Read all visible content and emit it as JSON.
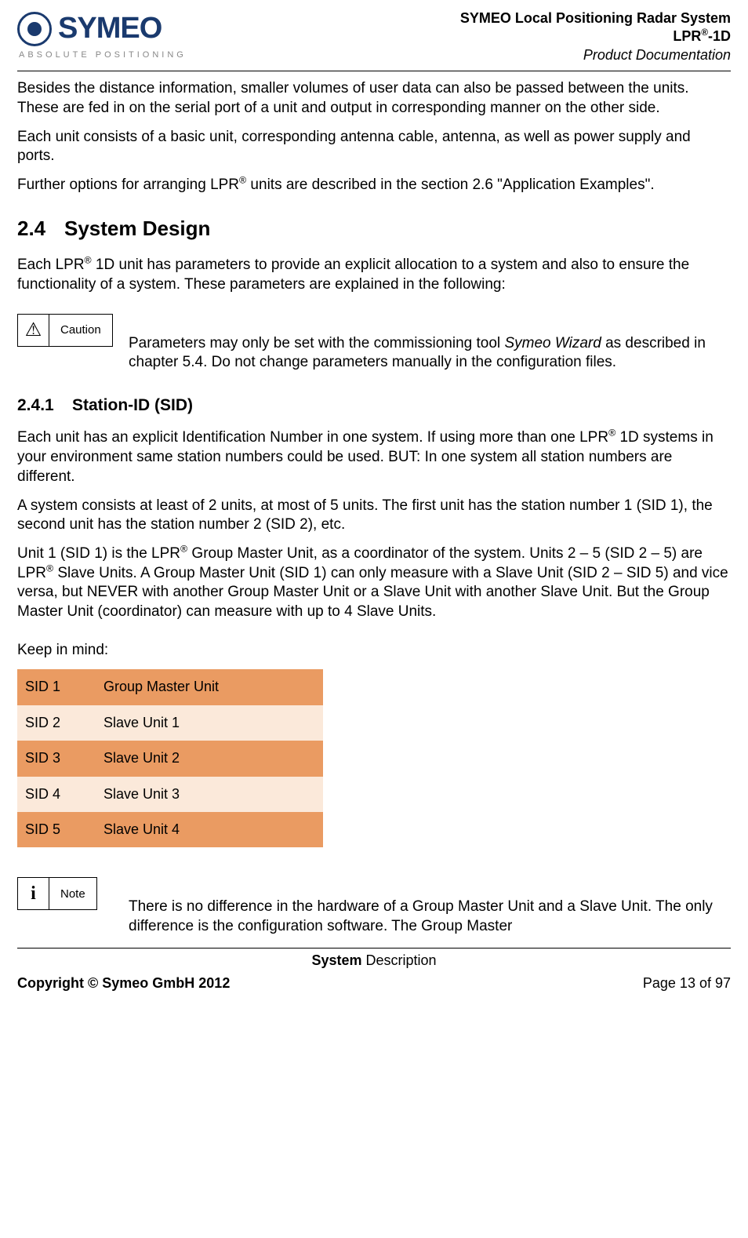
{
  "header": {
    "logo_text": "SYMEO",
    "logo_tagline": "ABSOLUTE POSITIONING",
    "line1": "SYMEO Local Positioning Radar System",
    "line2_prefix": "LPR",
    "line2_suffix": "-1D",
    "line3": "Product Documentation"
  },
  "body": {
    "p1": "Besides the distance information, smaller volumes of user data can also be passed between the units. These are fed in on the serial port of a unit and output in corresponding manner on the other side.",
    "p2": "Each unit consists of a basic unit, corresponding antenna cable, antenna, as well as power supply and ports.",
    "p3_a": "Further options for arranging LPR",
    "p3_b": " units are described in the section 2.6 \"Application Examples\".",
    "h2_num": "2.4",
    "h2_text": "System Design",
    "p4_a": "Each LPR",
    "p4_b": " 1D unit has parameters to provide an explicit allocation to a system and also to ensure the functionality of a system. These parameters are explained in the following:",
    "caution_label": "Caution",
    "caution_text_a": "Parameters may only be set with the commissioning tool ",
    "caution_text_b": "Symeo Wizard",
    "caution_text_c": " as described in chapter 5.4. Do not change parameters manually in the configuration files.",
    "h3_num": "2.4.1",
    "h3_text": "Station-ID (SID)",
    "p5_a": "Each unit has an explicit Identification Number in one system. If using more than one LPR",
    "p5_b": " 1D systems in your environment same station numbers could be used. BUT: In one system all station numbers are different.",
    "p6": "A system consists at least of 2 units, at most of 5 units. The first unit has the station number 1 (SID 1), the second unit has the station number 2 (SID 2), etc.",
    "p7_a": "Unit 1 (SID 1) is the LPR",
    "p7_b": " Group Master Unit, as a coordinator of the system. Units 2 – 5 (SID 2 – 5) are LPR",
    "p7_c": " Slave Units. A Group Master Unit (SID 1) can only measure with a Slave Unit (SID 2 – SID 5) and vice versa, but NEVER with another Group Master Unit or a Slave Unit with another Slave Unit. But the Group Master Unit (coordinator) can measure with up to 4 Slave Units.",
    "keep_in_mind": "Keep in mind:",
    "table": [
      {
        "sid": "SID 1",
        "role": "Group Master Unit"
      },
      {
        "sid": "SID 2",
        "role": "Slave Unit 1"
      },
      {
        "sid": "SID 3",
        "role": "Slave Unit 2"
      },
      {
        "sid": "SID 4",
        "role": "Slave Unit 3"
      },
      {
        "sid": "SID 5",
        "role": "Slave Unit 4"
      }
    ],
    "note_label": "Note",
    "note_text": "There is no difference in the hardware of a Group Master Unit and a Slave Unit. The only difference is the configuration software. The Group Master"
  },
  "footer": {
    "center_bold": "System",
    "center_rest": " Description",
    "copyright": "Copyright © Symeo GmbH 2012",
    "page": "Page 13 of 97"
  },
  "reg": "®"
}
